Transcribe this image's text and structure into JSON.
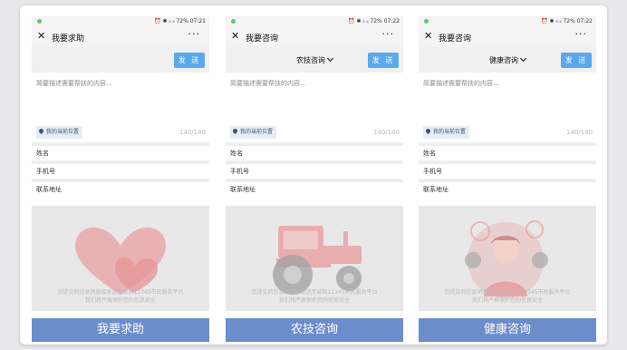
{
  "screens": [
    {
      "status": {
        "signal": "⏰ ✱ ᵢₗ ᵢₗ",
        "battery": "72%",
        "time": "07:21"
      },
      "title": "我要求助",
      "category": "",
      "send_label": "发 送",
      "placeholder": "简要描述需要帮扶的内容...",
      "location_label": "我的当前位置",
      "char_count": "140/140",
      "field_name": "姓名",
      "field_phone": "手机号",
      "field_address": "联系地址",
      "privacy_line1": "您提交的信息将直接发送至咸阳12345市民服务平台",
      "privacy_line2": "我们将严格保护您的信息安全",
      "button_label": "我要求助",
      "illustration": "heart"
    },
    {
      "status": {
        "signal": "⏰ ✱ ᵢₗ ᵢₗ",
        "battery": "72%",
        "time": "07:22"
      },
      "title": "我要咨询",
      "category": "农技咨询",
      "send_label": "发 送",
      "placeholder": "简要描述需要帮扶的内容...",
      "location_label": "我的当前位置",
      "char_count": "140/140",
      "field_name": "姓名",
      "field_phone": "手机号",
      "field_address": "联系地址",
      "privacy_line1": "您提交的信息将直接发送至咸阳12345市民服务平台",
      "privacy_line2": "我们将严格保护您的信息安全",
      "button_label": "农技咨询",
      "illustration": "tractor"
    },
    {
      "status": {
        "signal": "⏰ ✱ ᵢₗ ᵢₗ",
        "battery": "72%",
        "time": "07:22"
      },
      "title": "我要咨询",
      "category": "健康咨询",
      "send_label": "发 送",
      "placeholder": "简要描述需要帮扶的内容...",
      "location_label": "我的当前位置",
      "char_count": "140/140",
      "field_name": "姓名",
      "field_phone": "手机号",
      "field_address": "联系地址",
      "privacy_line1": "您提交的信息将直接发送至咸阳12345市民服务平台",
      "privacy_line2": "我们将严格保护您的信息安全",
      "button_label": "健康咨询",
      "illustration": "doctor"
    }
  ],
  "colors": {
    "accent": "#5aa8ee",
    "button": "#6c8dcc",
    "illustration": "#e9a0a0"
  }
}
